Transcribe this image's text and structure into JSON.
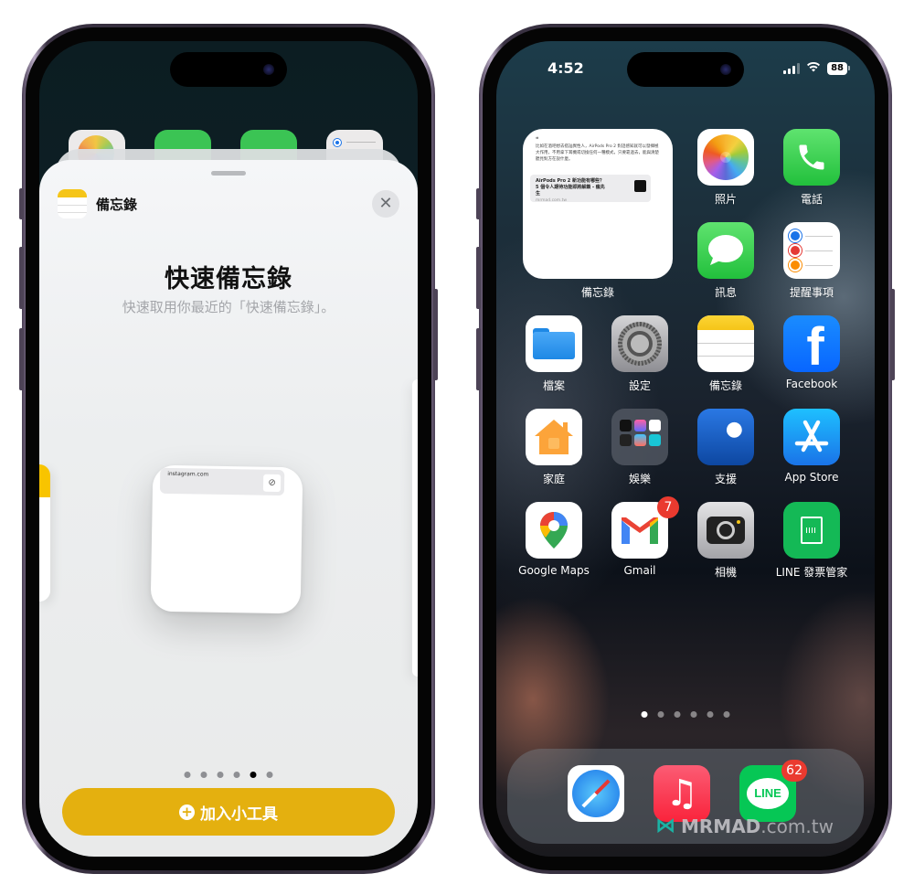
{
  "left_phone": {
    "background_app_icons": [
      "photos",
      "phone",
      "messages",
      "reminders"
    ],
    "sheet": {
      "app_name": "備忘錄",
      "close_label": "✕",
      "title": "快速備忘錄",
      "subtitle": "快速取用你最近的「快速備忘錄」。",
      "widget_preview": {
        "link_text": "instagram.com",
        "link_icon": "⊘"
      },
      "page_dots": {
        "count": 6,
        "active_index": 4
      },
      "add_button_label": "加入小工具",
      "add_button_icon": "+"
    },
    "colors": {
      "accent": "#e4b00f",
      "sheet_bg": "#eceeef"
    }
  },
  "right_phone": {
    "status_bar": {
      "time": "4:52",
      "battery": "88",
      "wifi_icon": "wifi-icon",
      "signal_bars": 3
    },
    "notes_widget": {
      "quote": "❝",
      "body": "比如在酒吧想去搭訕異性人，AirPods Pro 2 對話感知就可以發揮極大作用，不用拿下耳機或切換任何一種模式，只要靠過去，能與清楚聽見對方在說什麼。",
      "link_title": "AirPods Pro 2 新功能有哪些？5 個令人期待功能即將解鎖 - 瘋先生",
      "link_url": "mrmad.com.tw",
      "label": "備忘錄"
    },
    "apps": [
      {
        "id": "photos",
        "label": "照片"
      },
      {
        "id": "phone",
        "label": "電話"
      },
      {
        "id": "messages",
        "label": "訊息"
      },
      {
        "id": "reminders",
        "label": "提醒事項"
      },
      {
        "id": "files",
        "label": "檔案"
      },
      {
        "id": "settings",
        "label": "設定"
      },
      {
        "id": "notes",
        "label": "備忘錄"
      },
      {
        "id": "facebook",
        "label": "Facebook"
      },
      {
        "id": "home",
        "label": "家庭"
      },
      {
        "id": "entertainment-folder",
        "label": "娛樂"
      },
      {
        "id": "support",
        "label": "支援"
      },
      {
        "id": "app-store",
        "label": "App Store"
      },
      {
        "id": "google-maps",
        "label": "Google Maps"
      },
      {
        "id": "gmail",
        "label": "Gmail",
        "badge": "7"
      },
      {
        "id": "camera",
        "label": "相機"
      },
      {
        "id": "line-invoice",
        "label": "LINE 發票管家"
      }
    ],
    "page_dots": {
      "count": 6,
      "active_index": 0
    },
    "dock": [
      {
        "id": "safari"
      },
      {
        "id": "music"
      },
      {
        "id": "line",
        "badge": "62"
      }
    ],
    "watermark": {
      "brand": "MRMAD",
      "domain": ".com.tw"
    }
  }
}
